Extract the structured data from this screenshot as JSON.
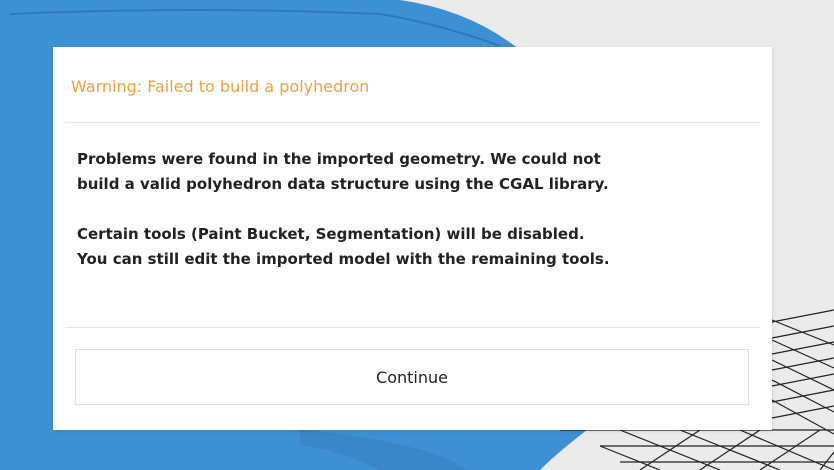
{
  "colors": {
    "background": "#ebebeb",
    "model_blue": "#3e90d4",
    "title_orange": "#f0a040",
    "text": "#222222"
  },
  "dialog": {
    "title": "Warning: Failed to build a polyhedron",
    "paragraph_1_line_1": "Problems were found in the imported geometry. We could not",
    "paragraph_1_line_2": "build a valid polyhedron data structure using the CGAL library.",
    "paragraph_2_line_1": "Certain tools (Paint Bucket, Segmentation) will be disabled.",
    "paragraph_2_line_2": "You can still edit the imported model with the remaining tools.",
    "continue_label": "Continue"
  }
}
